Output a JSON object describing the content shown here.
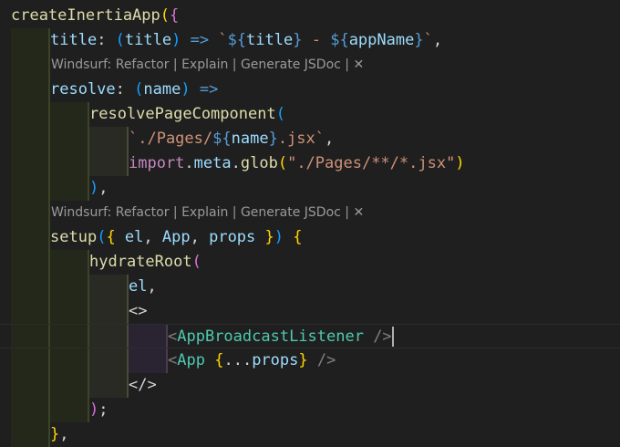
{
  "editor": {
    "lines": [
      {
        "segments": [
          {
            "t": "createInertiaApp",
            "c": "fn"
          },
          {
            "t": "(",
            "c": "y"
          },
          {
            "t": "{",
            "c": "pk"
          }
        ]
      },
      {
        "indent": 1,
        "segments": [
          {
            "t": "title",
            "c": "prop"
          },
          {
            "t": ": ",
            "c": "def"
          },
          {
            "t": "(",
            "c": "bl"
          },
          {
            "t": "title",
            "c": "prop"
          },
          {
            "t": ")",
            "c": "bl"
          },
          {
            "t": " => ",
            "c": "kw"
          },
          {
            "t": "`",
            "c": "str"
          },
          {
            "t": "${",
            "c": "tmpl"
          },
          {
            "t": "title",
            "c": "prop"
          },
          {
            "t": "}",
            "c": "tmpl"
          },
          {
            "t": " - ",
            "c": "str"
          },
          {
            "t": "${",
            "c": "tmpl"
          },
          {
            "t": "appName",
            "c": "prop"
          },
          {
            "t": "}",
            "c": "tmpl"
          },
          {
            "t": "`",
            "c": "str"
          },
          {
            "t": ",",
            "c": "def"
          }
        ]
      },
      {
        "codelens": true
      },
      {
        "indent": 1,
        "segments": [
          {
            "t": "resolve",
            "c": "prop"
          },
          {
            "t": ": ",
            "c": "def"
          },
          {
            "t": "(",
            "c": "bl"
          },
          {
            "t": "name",
            "c": "prop"
          },
          {
            "t": ")",
            "c": "bl"
          },
          {
            "t": " =>",
            "c": "kw"
          }
        ]
      },
      {
        "indent": 2,
        "segments": [
          {
            "t": "resolvePageComponent",
            "c": "fn"
          },
          {
            "t": "(",
            "c": "bl"
          }
        ]
      },
      {
        "indent": 3,
        "segments": [
          {
            "t": "`./Pages/",
            "c": "str"
          },
          {
            "t": "${",
            "c": "tmpl"
          },
          {
            "t": "name",
            "c": "prop"
          },
          {
            "t": "}",
            "c": "tmpl"
          },
          {
            "t": ".jsx`",
            "c": "str"
          },
          {
            "t": ",",
            "c": "def"
          }
        ]
      },
      {
        "indent": 3,
        "segments": [
          {
            "t": "import",
            "c": "kw2"
          },
          {
            "t": ".",
            "c": "def"
          },
          {
            "t": "meta",
            "c": "prop"
          },
          {
            "t": ".",
            "c": "def"
          },
          {
            "t": "glob",
            "c": "fn"
          },
          {
            "t": "(",
            "c": "y"
          },
          {
            "t": "\"./Pages/**/*.jsx\"",
            "c": "str"
          },
          {
            "t": ")",
            "c": "y"
          }
        ]
      },
      {
        "indent": 2,
        "segments": [
          {
            "t": ")",
            "c": "bl"
          },
          {
            "t": ",",
            "c": "def"
          }
        ]
      },
      {
        "codelens": true
      },
      {
        "indent": 1,
        "segments": [
          {
            "t": "setup",
            "c": "fn"
          },
          {
            "t": "(",
            "c": "bl"
          },
          {
            "t": "{",
            "c": "y"
          },
          {
            "t": " el",
            "c": "prop"
          },
          {
            "t": ", ",
            "c": "def"
          },
          {
            "t": "App",
            "c": "prop"
          },
          {
            "t": ", ",
            "c": "def"
          },
          {
            "t": "props",
            "c": "prop"
          },
          {
            "t": " }",
            "c": "y"
          },
          {
            "t": ")",
            "c": "bl"
          },
          {
            "t": " ",
            "c": "def"
          },
          {
            "t": "{",
            "c": "y"
          }
        ]
      },
      {
        "indent": 2,
        "segments": [
          {
            "t": "hydrateRoot",
            "c": "fn"
          },
          {
            "t": "(",
            "c": "pk"
          }
        ]
      },
      {
        "indent": 3,
        "segments": [
          {
            "t": "el",
            "c": "prop"
          },
          {
            "t": ",",
            "c": "def"
          }
        ]
      },
      {
        "indent": 3,
        "segments": [
          {
            "t": "<>",
            "c": "def"
          }
        ]
      },
      {
        "indent": 4,
        "current": true,
        "segments": [
          {
            "t": "<",
            "c": "tagb"
          },
          {
            "t": "AppBroadcastListener",
            "c": "tag"
          },
          {
            "t": " />",
            "c": "tagb"
          }
        ]
      },
      {
        "indent": 4,
        "segments": [
          {
            "t": "<",
            "c": "tagb"
          },
          {
            "t": "App",
            "c": "tag"
          },
          {
            "t": " ",
            "c": "def"
          },
          {
            "t": "{",
            "c": "y"
          },
          {
            "t": "...",
            "c": "def"
          },
          {
            "t": "props",
            "c": "prop"
          },
          {
            "t": "}",
            "c": "y"
          },
          {
            "t": " />",
            "c": "tagb"
          }
        ]
      },
      {
        "indent": 3,
        "segments": [
          {
            "t": "</",
            "c": "def"
          },
          {
            "t": ">",
            "c": "def"
          }
        ]
      },
      {
        "indent": 2,
        "segments": [
          {
            "t": ")",
            "c": "pk"
          },
          {
            "t": ";",
            "c": "def"
          }
        ]
      },
      {
        "indent": 1,
        "segments": [
          {
            "t": "}",
            "c": "y"
          },
          {
            "t": ",",
            "c": "def"
          }
        ]
      }
    ],
    "codelens": {
      "prefix": "Windsurf: ",
      "actions": [
        "Refactor",
        "Explain",
        "Generate JSDoc"
      ],
      "separator": " | ",
      "close": "✕"
    }
  },
  "colors": {
    "background": "#1f1f1f",
    "indent_band_1": "#262d1f",
    "indent_band_2": "#2a2a1c",
    "indent_band_3": "#2d2233",
    "indent_band_4": "#21302a"
  }
}
